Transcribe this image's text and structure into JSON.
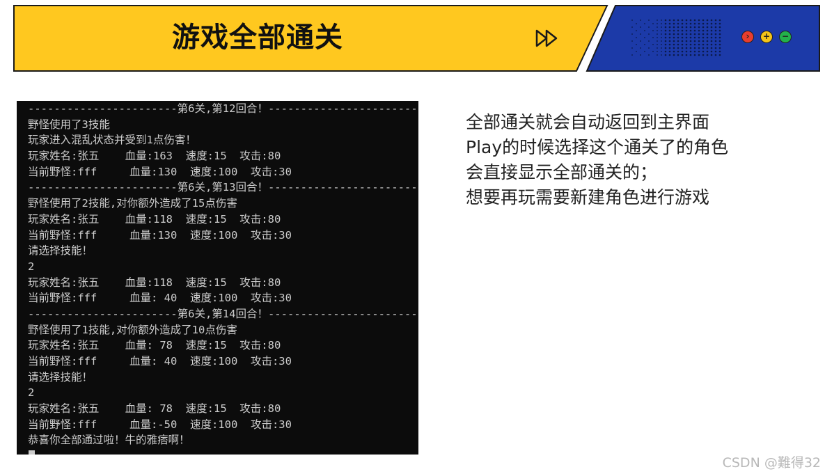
{
  "header": {
    "title": "游戏全部通关",
    "colors": {
      "yellow": "#ffc81f",
      "blue": "#1c3aa8",
      "outline": "#1a1a1a"
    },
    "icons": [
      "fast-forward-icon",
      "dot-grid-pattern",
      "close-icon",
      "plus-icon",
      "minus-icon"
    ],
    "window_buttons": {
      "close": "›",
      "max": "+",
      "min": "−"
    }
  },
  "console": {
    "lines": [
      "-----------------------第6关,第12回合！------------------------",
      "野怪使用了3技能",
      "玩家进入混乱状态并受到1点伤害！",
      "玩家姓名:张五    血量:163  速度:15  攻击:80",
      "当前野怪:fff     血量:130  速度:100  攻击:30",
      "-----------------------第6关,第13回合！------------------------",
      "野怪使用了2技能,对你额外造成了15点伤害",
      "玩家姓名:张五    血量:118  速度:15  攻击:80",
      "当前野怪:fff     血量:130  速度:100  攻击:30",
      "请选择技能！",
      "2",
      "玩家姓名:张五    血量:118  速度:15  攻击:80",
      "当前野怪:fff     血量: 40  速度:100  攻击:30",
      "-----------------------第6关,第14回合！------------------------",
      "野怪使用了1技能,对你额外造成了10点伤害",
      "玩家姓名:张五    血量: 78  速度:15  攻击:80",
      "当前野怪:fff     血量: 40  速度:100  攻击:30",
      "请选择技能！",
      "2",
      "玩家姓名:张五    血量: 78  速度:15  攻击:80",
      "当前野怪:fff     血量:-50  速度:100  攻击:30",
      "恭喜你全部通过啦！牛的雅痞啊！"
    ]
  },
  "notes": {
    "lines": [
      "全部通关就会自动返回到主界面",
      "Play的时候选择这个通关了的角色",
      "会直接显示全部通关的；",
      "想要再玩需要新建角色进行游戏"
    ]
  },
  "watermark": "CSDN @難得32"
}
